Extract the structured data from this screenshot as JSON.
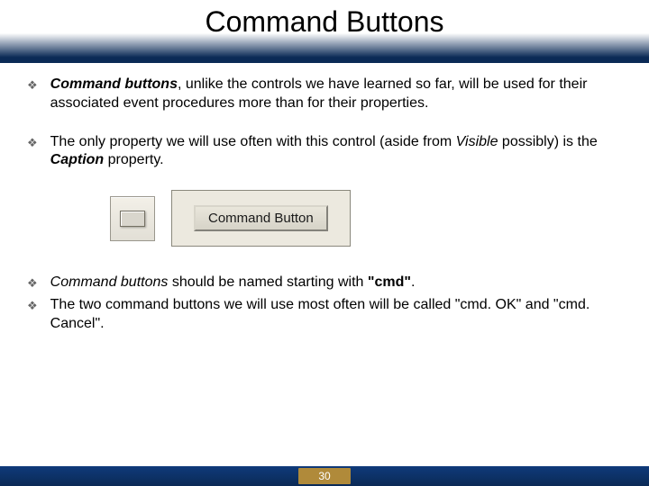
{
  "title": "Command Buttons",
  "bullets": {
    "b1": {
      "lead": "Command buttons",
      "rest": ", unlike the controls we have learned so far, will be used for their associated event procedures more than for their properties."
    },
    "b2": {
      "pre": "The only property we will use often with this control (aside from ",
      "visible": "Visible",
      "mid": " possibly) is the ",
      "caption": "Caption",
      "post": " property."
    },
    "b3": {
      "lead": "Command buttons",
      "mid": " should be named starting with ",
      "cmd": "\"cmd\"",
      "post": "."
    },
    "b4": {
      "text": "The two command buttons we will use most often will be called \"cmd. OK\" and \"cmd. Cancel\"."
    }
  },
  "sample_button_label": "Command Button",
  "page_number": "30"
}
